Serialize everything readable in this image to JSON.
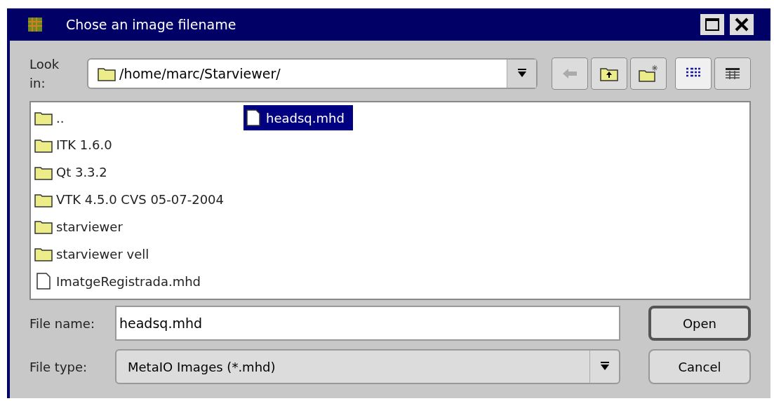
{
  "window": {
    "title": "Chose an image filename"
  },
  "look_in": {
    "label": "Look in:",
    "value": "/home/marc/Starviewer/"
  },
  "toolbar": {
    "back_disabled": true,
    "view_modes": [
      {
        "kind": "list",
        "selected": true
      },
      {
        "kind": "detail",
        "selected": false
      }
    ]
  },
  "files": [
    {
      "kind": "folder",
      "name": "..",
      "selected": false
    },
    {
      "kind": "folder",
      "name": "ITK 1.6.0",
      "selected": false
    },
    {
      "kind": "folder",
      "name": "Qt 3.3.2",
      "selected": false
    },
    {
      "kind": "folder",
      "name": "VTK 4.5.0 CVS 05-07-2004",
      "selected": false
    },
    {
      "kind": "folder",
      "name": "starviewer",
      "selected": false
    },
    {
      "kind": "folder",
      "name": "starviewer vell",
      "selected": false
    },
    {
      "kind": "file",
      "name": "ImatgeRegistrada.mhd",
      "selected": false
    },
    {
      "kind": "file",
      "name": "headsq.mhd",
      "selected": true
    }
  ],
  "file_name": {
    "label": "File name:",
    "value": "headsq.mhd"
  },
  "file_type": {
    "label": "File type:",
    "value": "MetaIO Images (*.mhd)"
  },
  "buttons": [
    "Open",
    "Cancel"
  ]
}
